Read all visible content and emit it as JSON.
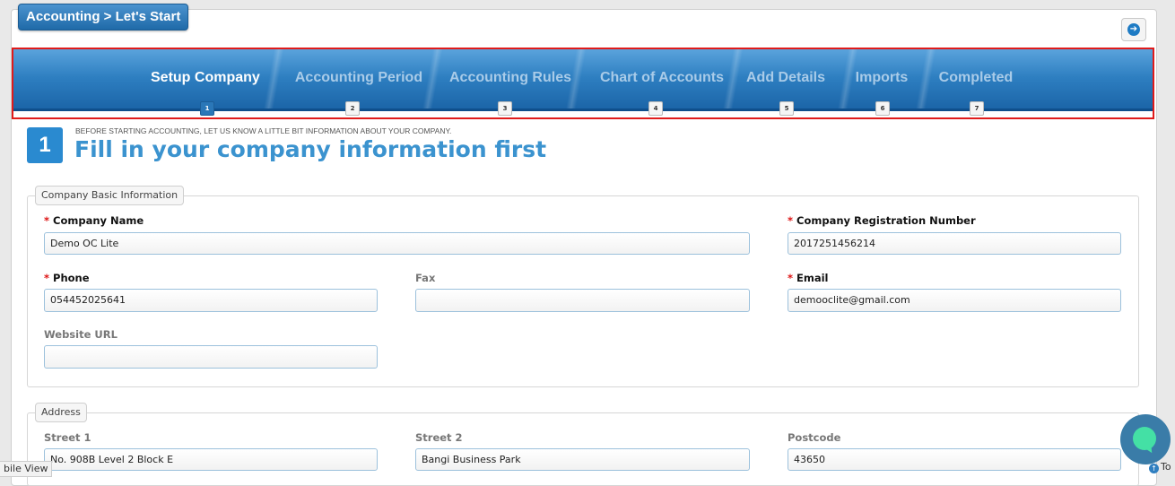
{
  "header": {
    "title": "Accounting > Let's Start",
    "next_icon": "arrow-right-circle-icon",
    "next_glyph": "➔"
  },
  "wizard": {
    "steps": [
      {
        "label": "Setup Company",
        "number": "1",
        "active": true
      },
      {
        "label": "Accounting Period",
        "number": "2",
        "active": false
      },
      {
        "label": "Accounting Rules",
        "number": "3",
        "active": false
      },
      {
        "label": "Chart of Accounts",
        "number": "4",
        "active": false
      },
      {
        "label": "Add Details",
        "number": "5",
        "active": false
      },
      {
        "label": "Imports",
        "number": "6",
        "active": false
      },
      {
        "label": "Completed",
        "number": "7",
        "active": false
      }
    ]
  },
  "intro": {
    "step_number": "1",
    "subtitle": "BEFORE STARTING ACCOUNTING, LET US KNOW A LITTLE BIT INFORMATION ABOUT YOUR COMPANY.",
    "heading": "Fill in your company information first"
  },
  "company_basic": {
    "legend": "Company Basic Information",
    "company_name": {
      "label": "Company Name",
      "value": "Demo OC Lite",
      "required": true
    },
    "registration_number": {
      "label": "Company Registration Number",
      "value": "2017251456214",
      "required": true
    },
    "phone": {
      "label": "Phone",
      "value": "054452025641",
      "required": true
    },
    "fax": {
      "label": "Fax",
      "value": ""
    },
    "email": {
      "label": "Email",
      "value": "demooclite@gmail.com",
      "required": true
    },
    "website": {
      "label": "Website URL",
      "value": ""
    }
  },
  "address": {
    "legend": "Address",
    "street1": {
      "label": "Street 1",
      "value": "No. 908B Level 2 Block E"
    },
    "street2": {
      "label": "Street 2",
      "value": "Bangi Business Park"
    },
    "postcode": {
      "label": "Postcode",
      "value": "43650"
    }
  },
  "required_marker": "*",
  "footer": {
    "mobile_view": "bile View",
    "top_link": "To",
    "up_glyph": "↑"
  },
  "colors": {
    "accent": "#3b93cf",
    "wizard_dark": "#1a63a6",
    "highlight_outline": "#e01b1b",
    "required": "#dd1111",
    "chat": "#44e0a5"
  }
}
